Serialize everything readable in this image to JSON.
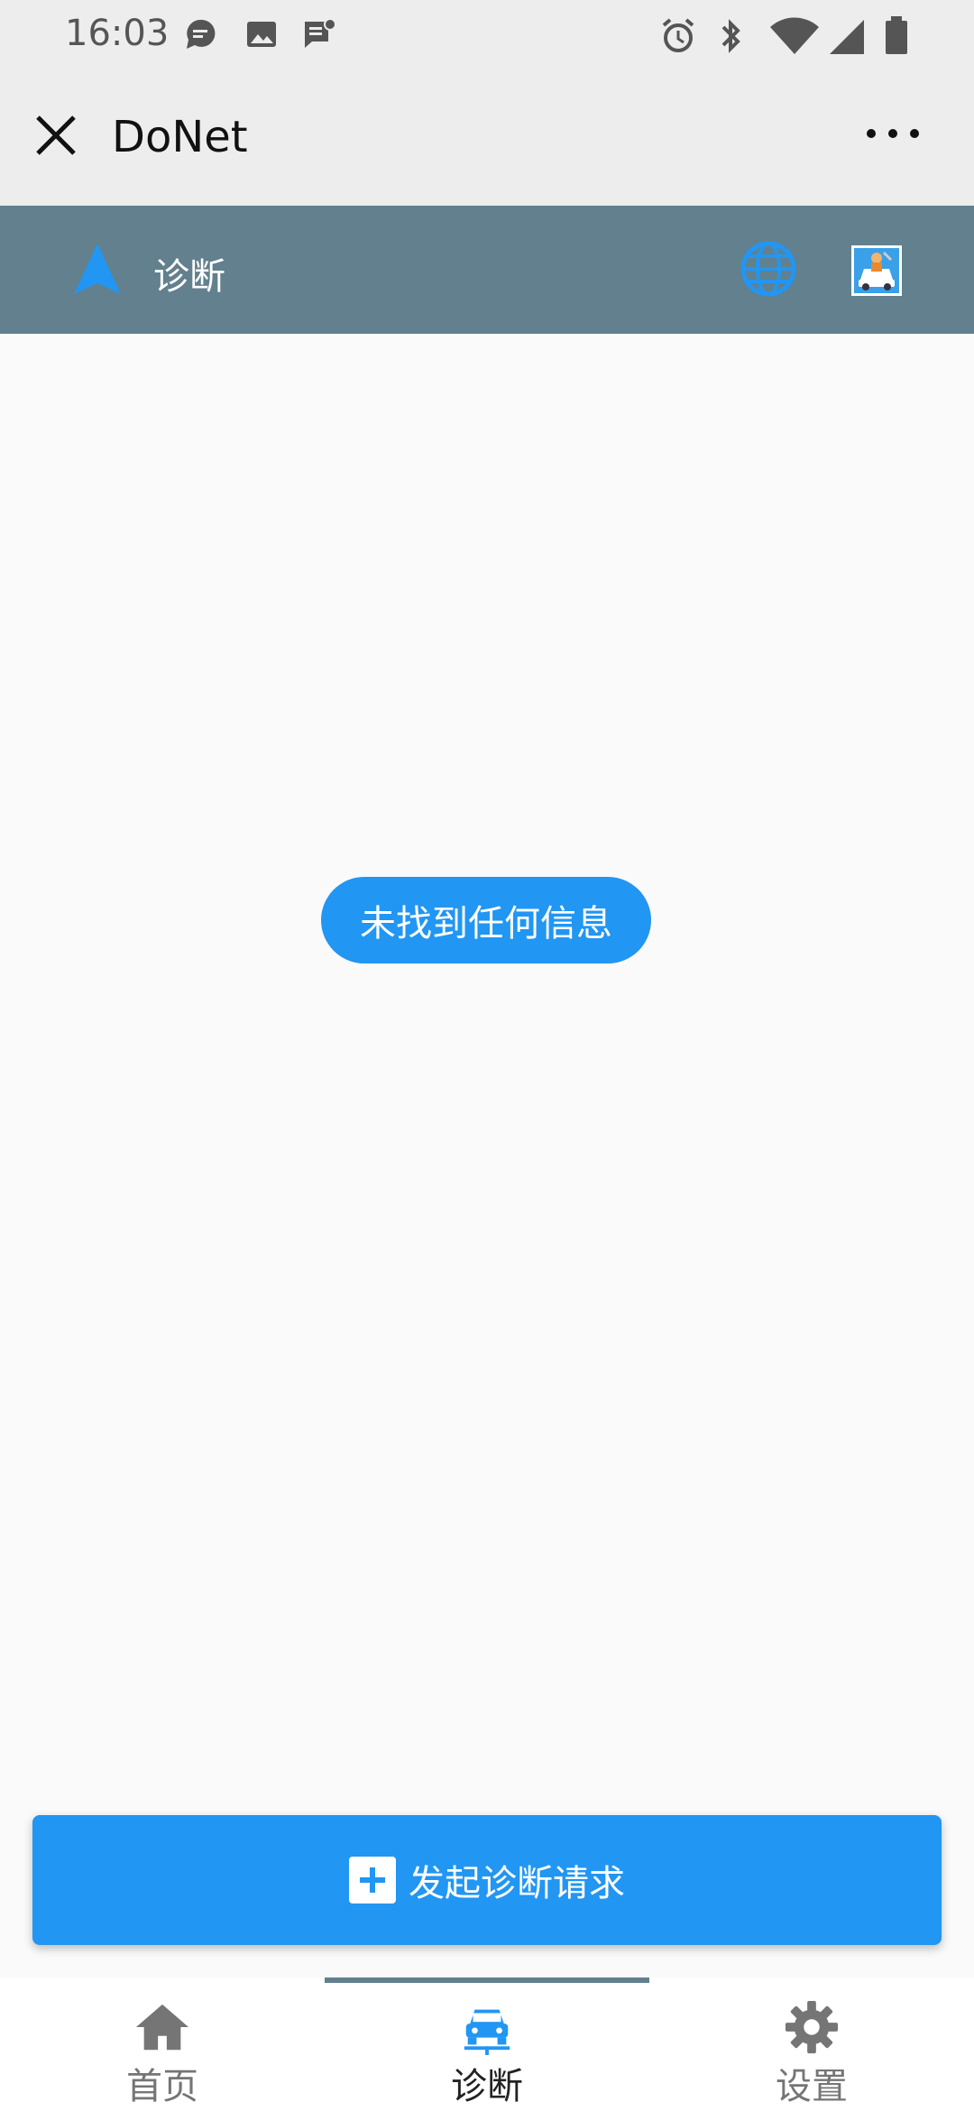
{
  "status_bar": {
    "time": "16:03",
    "icons": [
      "chat-bubble-icon",
      "image-icon",
      "message-icon",
      "alarm-icon",
      "bluetooth-icon",
      "wifi-icon",
      "signal-icon",
      "battery-icon"
    ]
  },
  "app_bar": {
    "title": "DoNet",
    "close_icon": "close-icon",
    "more_icon": "more-dots-icon"
  },
  "section_header": {
    "title": "诊断",
    "icons": [
      "navigation-arrow-icon",
      "globe-icon",
      "car-repair-icon"
    ]
  },
  "empty_state": {
    "message": "未找到任何信息"
  },
  "primary_button": {
    "label": "发起诊断请求",
    "icon": "plus-icon"
  },
  "bottom_nav": {
    "items": [
      {
        "label": "首页",
        "icon": "home-icon",
        "active": false
      },
      {
        "label": "诊断",
        "icon": "car-icon",
        "active": true
      },
      {
        "label": "设置",
        "icon": "gear-icon",
        "active": false
      }
    ]
  },
  "colors": {
    "accent": "#2196f3",
    "header": "#62808d",
    "chrome": "#ededed",
    "nav_inactive": "#757575",
    "nav_active_label": "#222222"
  }
}
